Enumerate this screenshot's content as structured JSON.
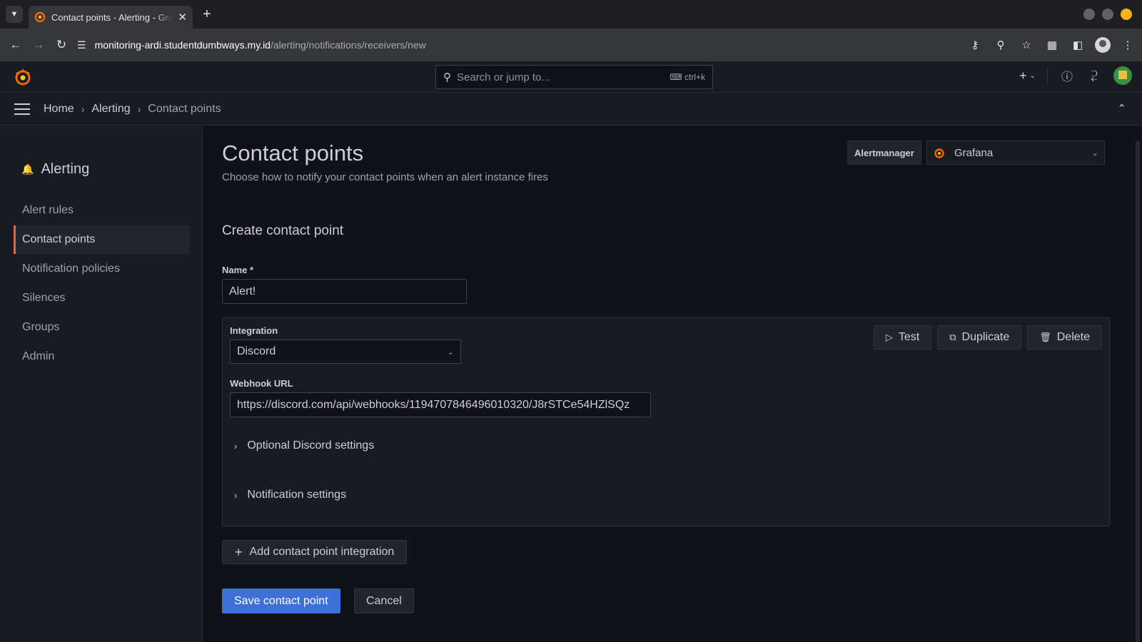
{
  "browser": {
    "tab_title": "Contact points - Alerting - Grafana",
    "url_host": "monitoring-ardi.studentdumbways.my.id",
    "url_path": "/alerting/notifications/receivers/new"
  },
  "topbar": {
    "search_placeholder": "Search or jump to...",
    "search_shortcut": "ctrl+k"
  },
  "breadcrumb": [
    "Home",
    "Alerting",
    "Contact points"
  ],
  "sidebar": {
    "title": "Alerting",
    "items": [
      {
        "label": "Alert rules",
        "active": false
      },
      {
        "label": "Contact points",
        "active": true
      },
      {
        "label": "Notification policies",
        "active": false
      },
      {
        "label": "Silences",
        "active": false
      },
      {
        "label": "Groups",
        "active": false
      },
      {
        "label": "Admin",
        "active": false
      }
    ]
  },
  "page": {
    "title": "Contact points",
    "subtitle": "Choose how to notify your contact points when an alert instance fires",
    "alertmanager_label": "Alertmanager",
    "alertmanager_value": "Grafana",
    "section_title": "Create contact point"
  },
  "form": {
    "name_label": "Name *",
    "name_value": "Alert!",
    "integration_label": "Integration",
    "integration_value": "Discord",
    "test_label": "Test",
    "duplicate_label": "Duplicate",
    "delete_label": "Delete",
    "webhook_label": "Webhook URL",
    "webhook_value": "https://discord.com/api/webhooks/1194707846496010320/J8rSTCe54HZlSQz",
    "optional_settings_label": "Optional Discord settings",
    "notification_settings_label": "Notification settings",
    "add_integration_label": "Add contact point integration",
    "save_label": "Save contact point",
    "cancel_label": "Cancel"
  },
  "colors": {
    "accent_primary": "#3d71d9",
    "active_indicator": "#f55f3e",
    "background": "#111217",
    "panel": "#181b1f"
  },
  "icons": {
    "tab_list": "chevron-down-icon",
    "back": "arrow-left-icon",
    "forward": "arrow-right-icon",
    "reload": "reload-icon",
    "site_info": "tune-icon",
    "password": "key-icon",
    "zoom": "zoom-icon",
    "bookmark": "star-icon",
    "extensions": "puzzle-icon",
    "help": "question-circle-icon",
    "news": "rss-icon",
    "sidebar_title": "bell-icon"
  }
}
